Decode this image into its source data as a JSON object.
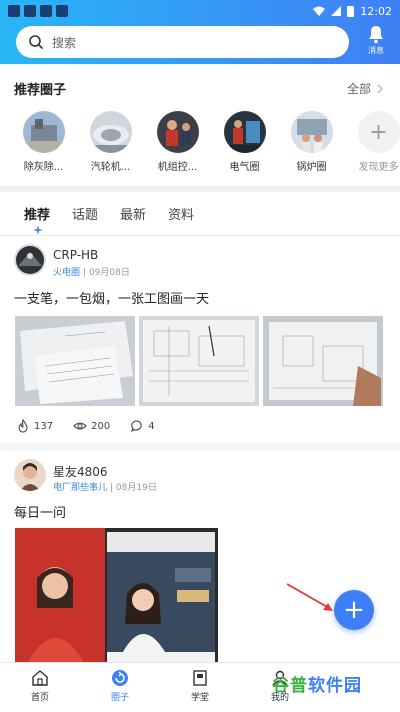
{
  "status_bar": {
    "time": "12:02"
  },
  "search": {
    "placeholder": "搜索"
  },
  "messages": {
    "label": "消息"
  },
  "recommended": {
    "title": "推荐圈子",
    "all_label": "全部",
    "circles": [
      {
        "label": "除灰除..."
      },
      {
        "label": "汽轮机..."
      },
      {
        "label": "机组控..."
      },
      {
        "label": "电气圈"
      },
      {
        "label": "锅炉圈"
      }
    ],
    "more_label": "发现更多"
  },
  "tabs": [
    {
      "label": "推荐"
    },
    {
      "label": "话题"
    },
    {
      "label": "最新"
    },
    {
      "label": "资料"
    }
  ],
  "posts": [
    {
      "author": "CRP-HB",
      "group": "火电圈",
      "date": "| 09月08日",
      "text": "一支笔，一包烟，一张工图画一天",
      "likes": "137",
      "views": "200",
      "comments": "4"
    },
    {
      "author": "星友4806",
      "group": "电厂那些事儿",
      "date": "| 08月19日",
      "text": "每日一问"
    }
  ],
  "bottom_nav": [
    {
      "label": "首页"
    },
    {
      "label": "圈子"
    },
    {
      "label": "学堂"
    },
    {
      "label": "我的"
    }
  ],
  "watermark": {
    "part1": "谷普",
    "part2": "软件园"
  },
  "colors": {
    "accent": "#3f7ff5",
    "header_start": "#29b6f6",
    "link": "#3b89f0"
  }
}
